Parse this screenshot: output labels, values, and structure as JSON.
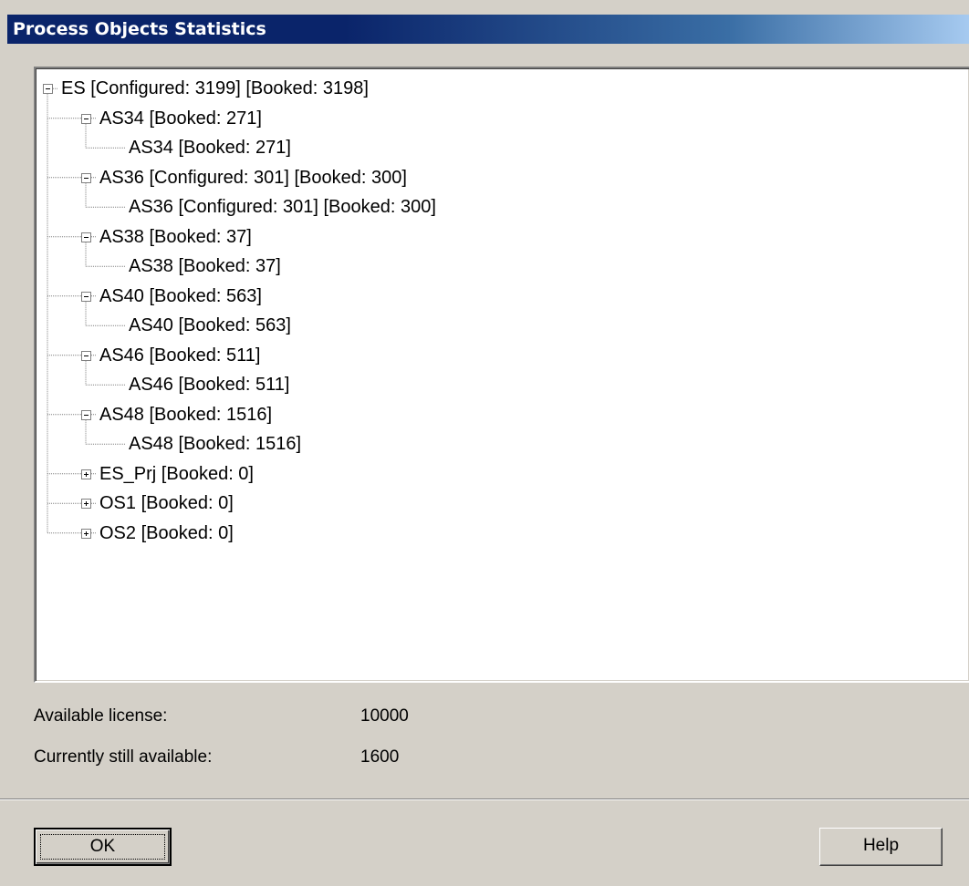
{
  "window": {
    "title": "Process Objects Statistics"
  },
  "tree": {
    "root": "ES [Configured: 3199] [Booked: 3198]",
    "nodes": [
      {
        "label": "AS34 [Booked: 271]",
        "child": "AS34 [Booked: 271]",
        "expanded": true
      },
      {
        "label": "AS36 [Configured: 301] [Booked: 300]",
        "child": "AS36 [Configured: 301] [Booked: 300]",
        "expanded": true
      },
      {
        "label": "AS38 [Booked: 37]",
        "child": "AS38 [Booked: 37]",
        "expanded": true
      },
      {
        "label": "AS40 [Booked: 563]",
        "child": "AS40 [Booked: 563]",
        "expanded": true
      },
      {
        "label": "AS46 [Booked: 511]",
        "child": "AS46 [Booked: 511]",
        "expanded": true
      },
      {
        "label": "AS48 [Booked: 1516]",
        "child": "AS48 [Booked: 1516]",
        "expanded": true
      },
      {
        "label": "ES_Prj [Booked: 0]",
        "expanded": false
      },
      {
        "label": "OS1 [Booked: 0]",
        "expanded": false
      },
      {
        "label": "OS2 [Booked: 0]",
        "expanded": false
      }
    ]
  },
  "license": {
    "available_label": "Available license:",
    "available_value": "10000",
    "remaining_label": "Currently still available:",
    "remaining_value": "1600"
  },
  "buttons": {
    "ok": "OK",
    "help": "Help"
  },
  "icons": {
    "expanded": "minus-box-icon",
    "collapsed": "plus-box-icon"
  }
}
